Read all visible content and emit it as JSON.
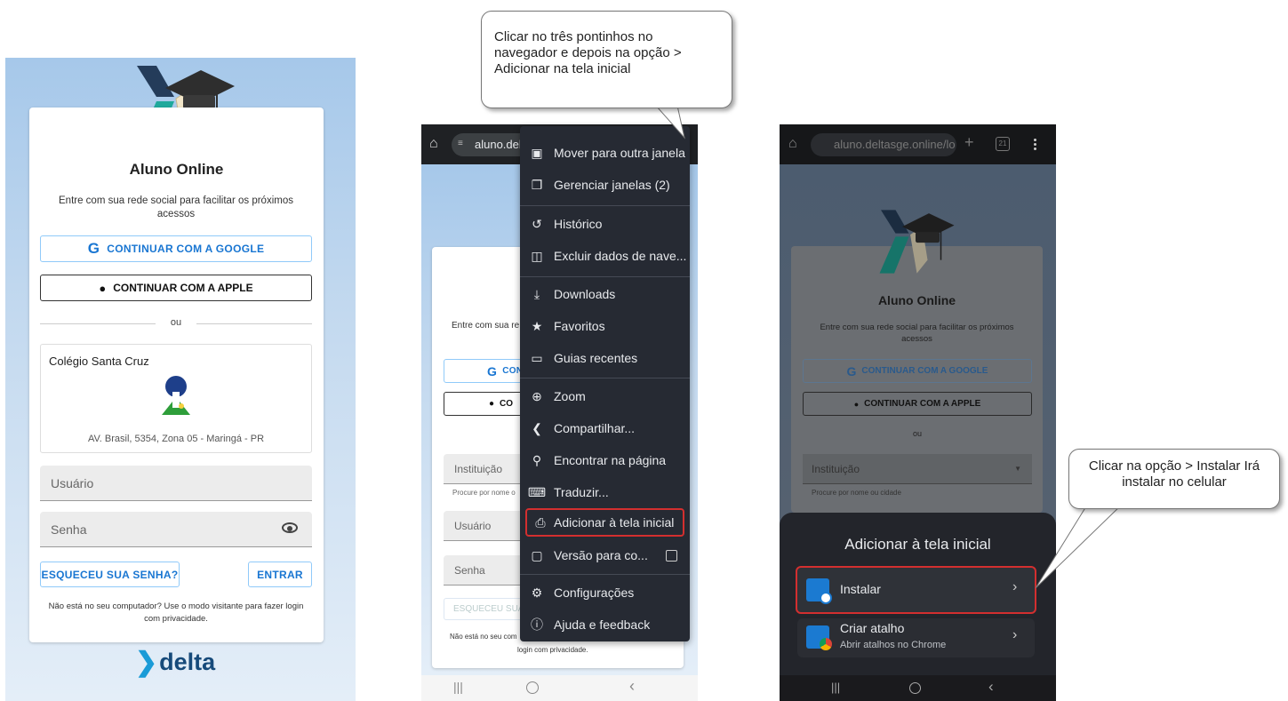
{
  "panel1": {
    "title": "Aluno Online",
    "subtitle": "Entre com sua rede social para facilitar os próximos acessos",
    "google_btn": "CONTINUAR COM A GOOGLE",
    "apple_btn": "CONTINUAR COM A APPLE",
    "divider": "ou",
    "school_name": "Colégio Santa Cruz",
    "school_address": "AV. Brasil, 5354, Zona 05 - Maringá - PR",
    "user_placeholder": "Usuário",
    "password_placeholder": "Senha",
    "forgot_btn": "ESQUECEU SUA SENHA?",
    "enter_btn": "ENTRAR",
    "visitor_note": "Não está no seu computador? Use o modo visitante para fazer login com privacidade.",
    "footer_logo": "delta"
  },
  "panel2": {
    "callout": "Clicar no três pontinhos no navegador e depois na opção > Adicionar na tela inicial",
    "url": "aluno.del",
    "subtitle_partial": "Entre com sua re",
    "google_partial": "CON",
    "apple_partial": "CO",
    "institution_label": "Instituição",
    "institution_helper": "Procure por nome o",
    "user_label": "Usuário",
    "password_label": "Senha",
    "forgot_partial": "ESQUECEU SUA",
    "visitor_partial": "Não está no seu com",
    "visitor_partial2": "login com privacidade.",
    "menu": [
      {
        "label": "Mover para outra janela",
        "icon": "move-window-icon"
      },
      {
        "label": "Gerenciar janelas (2)",
        "icon": "manage-windows-icon"
      },
      {
        "label": "Histórico",
        "icon": "history-icon"
      },
      {
        "label": "Excluir dados de nave...",
        "icon": "trash-icon"
      },
      {
        "label": "Downloads",
        "icon": "download-icon"
      },
      {
        "label": "Favoritos",
        "icon": "star-icon"
      },
      {
        "label": "Guias recentes",
        "icon": "recent-tabs-icon"
      },
      {
        "label": "Zoom",
        "icon": "zoom-icon"
      },
      {
        "label": "Compartilhar...",
        "icon": "share-icon"
      },
      {
        "label": "Encontrar na página",
        "icon": "find-icon"
      },
      {
        "label": "Traduzir...",
        "icon": "translate-icon"
      },
      {
        "label": "Adicionar à tela inicial",
        "icon": "add-home-icon"
      },
      {
        "label": "Versão para co...",
        "icon": "desktop-icon"
      },
      {
        "label": "Configurações",
        "icon": "gear-icon"
      },
      {
        "label": "Ajuda e feedback",
        "icon": "help-icon"
      }
    ]
  },
  "panel3": {
    "url": "aluno.deltasge.online/lo",
    "tab_count": "21",
    "title": "Aluno Online",
    "subtitle": "Entre com sua rede social para facilitar os próximos acessos",
    "google_btn": "CONTINUAR COM A GOOGLE",
    "apple_btn": "CONTINUAR COM A APPLE",
    "divider": "ou",
    "institution_label": "Instituição",
    "institution_helper": "Procure por nome ou cidade",
    "sheet_title": "Adicionar à tela inicial",
    "install_label": "Instalar",
    "shortcut_label": "Criar atalho",
    "shortcut_sub": "Abrir atalhos no Chrome",
    "callout": "Clicar na opção > Instalar Irá instalar no celular"
  },
  "colors": {
    "accent_blue": "#1976d2",
    "highlight_red": "#d32f2f",
    "menu_bg": "#262a33",
    "sheet_bg": "#23252b"
  }
}
